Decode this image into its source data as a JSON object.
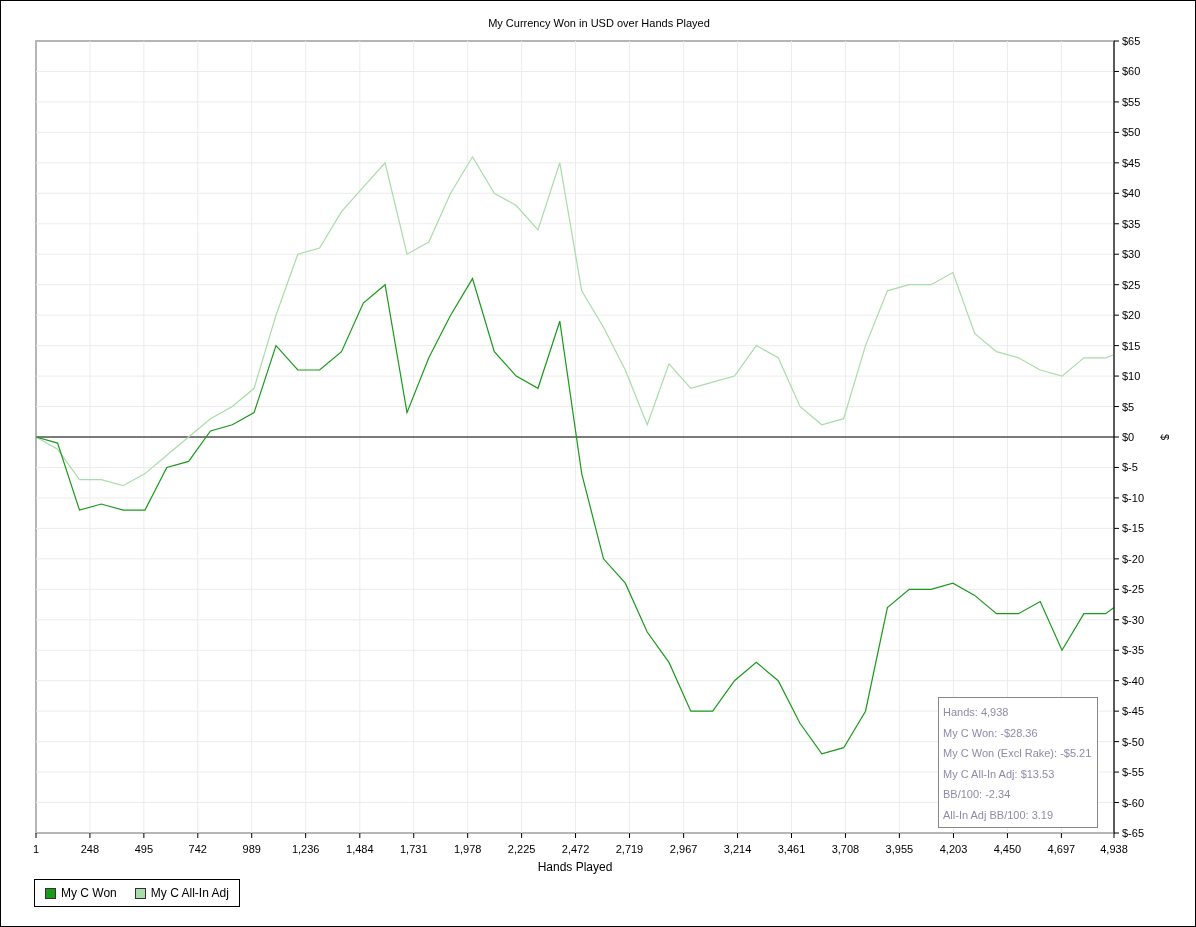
{
  "chart": {
    "chart_data": {
      "type": "line",
      "title": "My Currency Won in USD over Hands Played",
      "xlabel": "Hands Played",
      "ylabel": "$",
      "x": [
        1,
        100,
        200,
        300,
        400,
        500,
        600,
        700,
        800,
        900,
        1000,
        1100,
        1200,
        1300,
        1400,
        1500,
        1600,
        1700,
        1800,
        1900,
        2000,
        2100,
        2200,
        2300,
        2400,
        2500,
        2600,
        2700,
        2800,
        2900,
        3000,
        3100,
        3200,
        3300,
        3400,
        3500,
        3600,
        3700,
        3800,
        3900,
        4000,
        4100,
        4200,
        4300,
        4400,
        4500,
        4600,
        4700,
        4800,
        4900,
        4938
      ],
      "series": [
        {
          "name": "My C Won",
          "color": "#1a9a1a",
          "values": [
            0,
            -1,
            -12,
            -11,
            -12,
            -12,
            -5,
            -4,
            1,
            2,
            4,
            15,
            11,
            11,
            14,
            22,
            25,
            4,
            13,
            20,
            26,
            14,
            10,
            8,
            19,
            -6,
            -20,
            -24,
            -32,
            -37,
            -45,
            -45,
            -40,
            -37,
            -40,
            -47,
            -52,
            -51,
            -45,
            -28,
            -25,
            -25,
            -24,
            -26,
            -29,
            -29,
            -27,
            -35,
            -29,
            -29,
            -28
          ]
        },
        {
          "name": "My C All-In Adj",
          "color": "#a8dca8",
          "values": [
            0,
            -2,
            -7,
            -7,
            -8,
            -6,
            -3,
            0,
            3,
            5,
            8,
            20,
            30,
            31,
            37,
            41,
            45,
            30,
            32,
            40,
            46,
            40,
            38,
            34,
            45,
            24,
            18,
            11,
            2,
            12,
            8,
            9,
            10,
            15,
            13,
            5,
            2,
            3,
            15,
            24,
            25,
            25,
            27,
            17,
            14,
            13,
            11,
            10,
            13,
            13,
            13.5
          ]
        }
      ],
      "grid": true,
      "xlim": [
        1,
        4938
      ],
      "ylim": [
        -65,
        65
      ],
      "xticks": [
        1,
        {
          "value": 248,
          "label": "248"
        },
        {
          "value": 495,
          "label": "495"
        },
        {
          "value": 742,
          "label": "742"
        },
        {
          "value": 989,
          "label": "989"
        },
        {
          "value": 1236,
          "label": "1,236"
        },
        {
          "value": 1484,
          "label": "1,484"
        },
        {
          "value": 1731,
          "label": "1,731"
        },
        {
          "value": 1978,
          "label": "1,978"
        },
        {
          "value": 2225,
          "label": "2,225"
        },
        {
          "value": 2472,
          "label": "2,472"
        },
        {
          "value": 2719,
          "label": "2,719"
        },
        {
          "value": 2967,
          "label": "2,967"
        },
        {
          "value": 3214,
          "label": "3,214"
        },
        {
          "value": 3461,
          "label": "3,461"
        },
        {
          "value": 3708,
          "label": "3,708"
        },
        {
          "value": 3955,
          "label": "3,955"
        },
        {
          "value": 4203,
          "label": "4,203"
        },
        {
          "value": 4450,
          "label": "4,450"
        },
        {
          "value": 4697,
          "label": "4,697"
        },
        {
          "value": 4938,
          "label": "4,938"
        }
      ],
      "yticks": [
        {
          "value": 65,
          "label": "$65"
        },
        {
          "value": 60,
          "label": "$60"
        },
        {
          "value": 55,
          "label": "$55"
        },
        {
          "value": 50,
          "label": "$50"
        },
        {
          "value": 45,
          "label": "$45"
        },
        {
          "value": 40,
          "label": "$40"
        },
        {
          "value": 35,
          "label": "$35"
        },
        {
          "value": 30,
          "label": "$30"
        },
        {
          "value": 25,
          "label": "$25"
        },
        {
          "value": 20,
          "label": "$20"
        },
        {
          "value": 15,
          "label": "$15"
        },
        {
          "value": 10,
          "label": "$10"
        },
        {
          "value": 5,
          "label": "$5"
        },
        {
          "value": 0,
          "label": "$0"
        },
        {
          "value": -5,
          "label": "$-5"
        },
        {
          "value": -10,
          "label": "$-10"
        },
        {
          "value": -15,
          "label": "$-15"
        },
        {
          "value": -20,
          "label": "$-20"
        },
        {
          "value": -25,
          "label": "$-25"
        },
        {
          "value": -30,
          "label": "$-30"
        },
        {
          "value": -35,
          "label": "$-35"
        },
        {
          "value": -40,
          "label": "$-40"
        },
        {
          "value": -45,
          "label": "$-45"
        },
        {
          "value": -50,
          "label": "$-50"
        },
        {
          "value": -55,
          "label": "$-55"
        },
        {
          "value": -60,
          "label": "$-60"
        },
        {
          "value": -65,
          "label": "$-65"
        }
      ]
    },
    "summary": [
      "Hands: 4,938",
      "My C Won: -$28.36",
      "My C Won (Excl Rake): -$5.21",
      "My C All-In Adj: $13.53",
      "BB/100: -2.34",
      "All-In Adj BB/100: 3.19"
    ]
  }
}
